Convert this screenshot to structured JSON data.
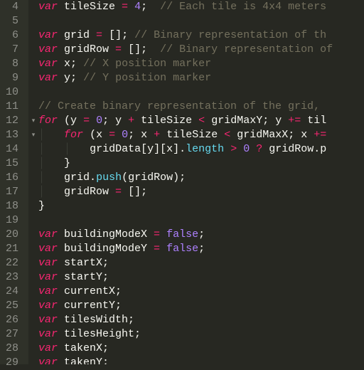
{
  "editor": {
    "lines": [
      {
        "num": 4,
        "indent": 0,
        "tokens": [
          [
            "kw",
            "var"
          ],
          [
            "id",
            " tileSize "
          ],
          [
            "op",
            "="
          ],
          [
            "id",
            " "
          ],
          [
            "num",
            "4"
          ],
          [
            "pun",
            ";"
          ],
          [
            "id",
            "  "
          ],
          [
            "com",
            "// Each tile is 4x4 meters"
          ]
        ]
      },
      {
        "num": 5,
        "indent": 0,
        "tokens": []
      },
      {
        "num": 6,
        "indent": 0,
        "tokens": [
          [
            "kw",
            "var"
          ],
          [
            "id",
            " grid "
          ],
          [
            "op",
            "="
          ],
          [
            "id",
            " "
          ],
          [
            "pun",
            "[];"
          ],
          [
            "id",
            " "
          ],
          [
            "com",
            "// Binary representation of th"
          ]
        ]
      },
      {
        "num": 7,
        "indent": 0,
        "tokens": [
          [
            "kw",
            "var"
          ],
          [
            "id",
            " gridRow "
          ],
          [
            "op",
            "="
          ],
          [
            "id",
            " "
          ],
          [
            "pun",
            "[];"
          ],
          [
            "id",
            "  "
          ],
          [
            "com",
            "// Binary representation of"
          ]
        ]
      },
      {
        "num": 8,
        "indent": 0,
        "tokens": [
          [
            "kw",
            "var"
          ],
          [
            "id",
            " x"
          ],
          [
            "pun",
            ";"
          ],
          [
            "id",
            " "
          ],
          [
            "com",
            "// X position marker"
          ]
        ]
      },
      {
        "num": 9,
        "indent": 0,
        "tokens": [
          [
            "kw",
            "var"
          ],
          [
            "id",
            " y"
          ],
          [
            "pun",
            ";"
          ],
          [
            "id",
            " "
          ],
          [
            "com",
            "// Y position marker"
          ]
        ]
      },
      {
        "num": 10,
        "indent": 0,
        "tokens": []
      },
      {
        "num": 11,
        "indent": 0,
        "tokens": [
          [
            "com",
            "// Create binary representation of the grid, "
          ]
        ]
      },
      {
        "num": 12,
        "indent": 0,
        "fold": true,
        "tokens": [
          [
            "kw",
            "for"
          ],
          [
            "id",
            " "
          ],
          [
            "pun",
            "("
          ],
          [
            "id",
            "y "
          ],
          [
            "op",
            "="
          ],
          [
            "id",
            " "
          ],
          [
            "num",
            "0"
          ],
          [
            "pun",
            ";"
          ],
          [
            "id",
            " y "
          ],
          [
            "op",
            "+"
          ],
          [
            "id",
            " tileSize "
          ],
          [
            "op",
            "<"
          ],
          [
            "id",
            " gridMaxY"
          ],
          [
            "pun",
            ";"
          ],
          [
            "id",
            " y "
          ],
          [
            "op",
            "+="
          ],
          [
            "id",
            " til"
          ]
        ]
      },
      {
        "num": 13,
        "indent": 1,
        "fold": true,
        "tokens": [
          [
            "kw",
            "for"
          ],
          [
            "id",
            " "
          ],
          [
            "pun",
            "("
          ],
          [
            "id",
            "x "
          ],
          [
            "op",
            "="
          ],
          [
            "id",
            " "
          ],
          [
            "num",
            "0"
          ],
          [
            "pun",
            ";"
          ],
          [
            "id",
            " x "
          ],
          [
            "op",
            "+"
          ],
          [
            "id",
            " tileSize "
          ],
          [
            "op",
            "<"
          ],
          [
            "id",
            " gridMaxX"
          ],
          [
            "pun",
            ";"
          ],
          [
            "id",
            " x "
          ],
          [
            "op",
            "+="
          ]
        ]
      },
      {
        "num": 14,
        "indent": 2,
        "tokens": [
          [
            "id",
            "gridData"
          ],
          [
            "pun",
            "["
          ],
          [
            "id",
            "y"
          ],
          [
            "pun",
            "]["
          ],
          [
            "id",
            "x"
          ],
          [
            "pun",
            "]."
          ],
          [
            "fn",
            "length"
          ],
          [
            "id",
            " "
          ],
          [
            "op",
            ">"
          ],
          [
            "id",
            " "
          ],
          [
            "num",
            "0"
          ],
          [
            "id",
            " "
          ],
          [
            "op",
            "?"
          ],
          [
            "id",
            " gridRow"
          ],
          [
            "pun",
            "."
          ],
          [
            "id",
            "p"
          ]
        ]
      },
      {
        "num": 15,
        "indent": 1,
        "tokens": [
          [
            "pun",
            "}"
          ]
        ]
      },
      {
        "num": 16,
        "indent": 1,
        "tokens": [
          [
            "id",
            "grid"
          ],
          [
            "pun",
            "."
          ],
          [
            "fn",
            "push"
          ],
          [
            "pun",
            "("
          ],
          [
            "id",
            "gridRow"
          ],
          [
            "pun",
            ");"
          ]
        ]
      },
      {
        "num": 17,
        "indent": 1,
        "tokens": [
          [
            "id",
            "gridRow "
          ],
          [
            "op",
            "="
          ],
          [
            "id",
            " "
          ],
          [
            "pun",
            "[];"
          ]
        ]
      },
      {
        "num": 18,
        "indent": 0,
        "tokens": [
          [
            "pun",
            "}"
          ]
        ]
      },
      {
        "num": 19,
        "indent": 0,
        "tokens": []
      },
      {
        "num": 20,
        "indent": 0,
        "tokens": [
          [
            "kw",
            "var"
          ],
          [
            "id",
            " buildingModeX "
          ],
          [
            "op",
            "="
          ],
          [
            "id",
            " "
          ],
          [
            "bool",
            "false"
          ],
          [
            "pun",
            ";"
          ]
        ]
      },
      {
        "num": 21,
        "indent": 0,
        "tokens": [
          [
            "kw",
            "var"
          ],
          [
            "id",
            " buildingModeY "
          ],
          [
            "op",
            "="
          ],
          [
            "id",
            " "
          ],
          [
            "bool",
            "false"
          ],
          [
            "pun",
            ";"
          ]
        ]
      },
      {
        "num": 22,
        "indent": 0,
        "tokens": [
          [
            "kw",
            "var"
          ],
          [
            "id",
            " startX"
          ],
          [
            "pun",
            ";"
          ]
        ]
      },
      {
        "num": 23,
        "indent": 0,
        "tokens": [
          [
            "kw",
            "var"
          ],
          [
            "id",
            " startY"
          ],
          [
            "pun",
            ";"
          ]
        ]
      },
      {
        "num": 24,
        "indent": 0,
        "tokens": [
          [
            "kw",
            "var"
          ],
          [
            "id",
            " currentX"
          ],
          [
            "pun",
            ";"
          ]
        ]
      },
      {
        "num": 25,
        "indent": 0,
        "tokens": [
          [
            "kw",
            "var"
          ],
          [
            "id",
            " currentY"
          ],
          [
            "pun",
            ";"
          ]
        ]
      },
      {
        "num": 26,
        "indent": 0,
        "tokens": [
          [
            "kw",
            "var"
          ],
          [
            "id",
            " tilesWidth"
          ],
          [
            "pun",
            ";"
          ]
        ]
      },
      {
        "num": 27,
        "indent": 0,
        "tokens": [
          [
            "kw",
            "var"
          ],
          [
            "id",
            " tilesHeight"
          ],
          [
            "pun",
            ";"
          ]
        ]
      },
      {
        "num": 28,
        "indent": 0,
        "tokens": [
          [
            "kw",
            "var"
          ],
          [
            "id",
            " takenX"
          ],
          [
            "pun",
            ";"
          ]
        ]
      },
      {
        "num": 29,
        "indent": 0,
        "tokens": [
          [
            "kw",
            "var"
          ],
          [
            "id",
            " takenY"
          ],
          [
            "pun",
            ";"
          ]
        ]
      }
    ]
  }
}
